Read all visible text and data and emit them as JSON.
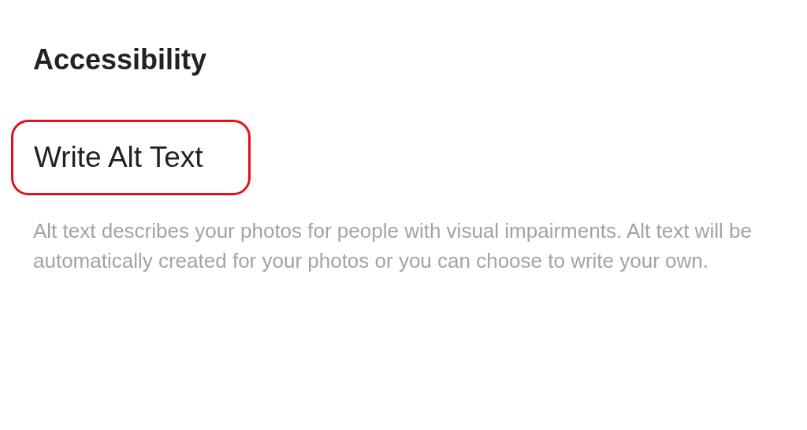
{
  "section": {
    "title": "Accessibility"
  },
  "setting": {
    "label": "Write Alt Text",
    "highlighted": true
  },
  "description": "Alt text describes your photos for people with visual impairments. Alt text will be automatically created for your photos or you can choose to write your own."
}
